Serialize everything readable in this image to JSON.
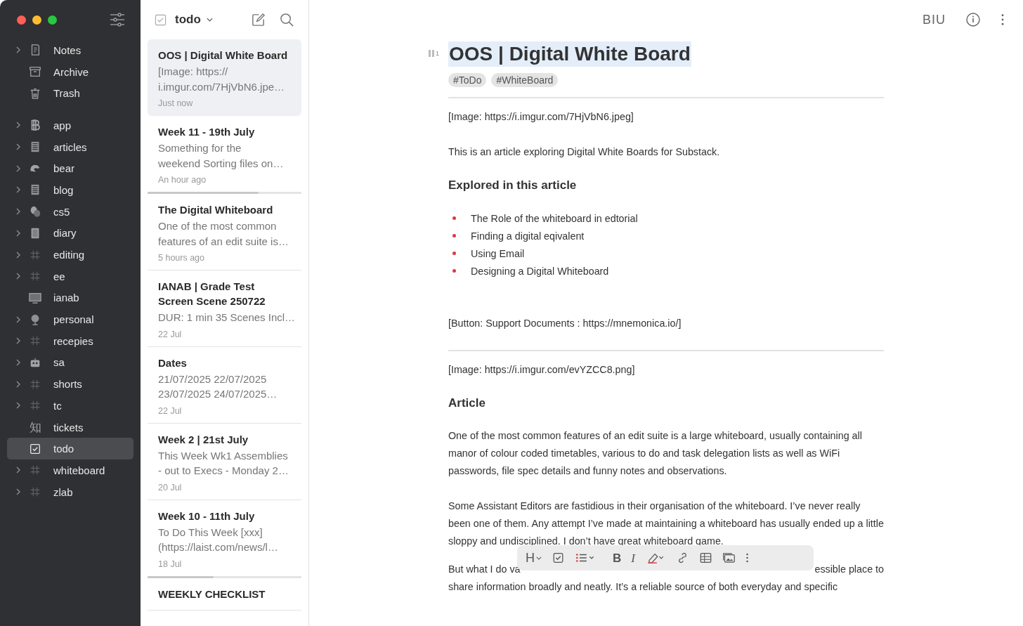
{
  "sidebar": {
    "items": [
      {
        "label": "Notes",
        "expandable": true,
        "selected": false
      },
      {
        "label": "Archive",
        "expandable": false,
        "selected": false
      },
      {
        "label": "Trash",
        "expandable": false,
        "selected": false
      },
      {
        "label": "app",
        "expandable": true,
        "selected": false
      },
      {
        "label": "articles",
        "expandable": true,
        "selected": false
      },
      {
        "label": "bear",
        "expandable": true,
        "selected": false
      },
      {
        "label": "blog",
        "expandable": true,
        "selected": false
      },
      {
        "label": "cs5",
        "expandable": true,
        "selected": false
      },
      {
        "label": "diary",
        "expandable": true,
        "selected": false
      },
      {
        "label": "editing",
        "expandable": true,
        "selected": false
      },
      {
        "label": "ee",
        "expandable": true,
        "selected": false
      },
      {
        "label": "ianab",
        "expandable": false,
        "selected": false
      },
      {
        "label": "personal",
        "expandable": true,
        "selected": false
      },
      {
        "label": "recepies",
        "expandable": true,
        "selected": false
      },
      {
        "label": "sa",
        "expandable": true,
        "selected": false
      },
      {
        "label": "shorts",
        "expandable": true,
        "selected": false
      },
      {
        "label": "tc",
        "expandable": true,
        "selected": false
      },
      {
        "label": "tickets",
        "expandable": false,
        "selected": false,
        "icon_text": "知"
      },
      {
        "label": "todo",
        "expandable": false,
        "selected": true
      },
      {
        "label": "whiteboard",
        "expandable": true,
        "selected": false
      },
      {
        "label": "zlab",
        "expandable": true,
        "selected": false
      }
    ]
  },
  "note_list": {
    "title": "todo",
    "notes": [
      {
        "title": "OOS | Digital White Board",
        "preview": [
          "[Image: https://",
          "i.imgur.com/7HjVbN6.jpe…"
        ],
        "date": "Just now",
        "selected": true
      },
      {
        "title": "Week 11 - 19th July",
        "preview": [
          "Something for the",
          "weekend Sorting files on…"
        ],
        "date": "An hour ago",
        "selected": false,
        "level": 0.72
      },
      {
        "title": "The Digital Whiteboard",
        "preview": [
          "One of the most common",
          "features of an edit suite is…"
        ],
        "date": "5 hours ago",
        "selected": false
      },
      {
        "title": "IANAB | Grade Test Screen Scene 250722",
        "preview": [
          "DUR: 1 min 35 Scenes Incl…"
        ],
        "date": "22 Jul",
        "selected": false
      },
      {
        "title": "Dates",
        "preview": [
          "21/07/2025 22/07/2025",
          "23/07/2025 24/07/2025…"
        ],
        "date": "22 Jul",
        "selected": false
      },
      {
        "title": "Week 2 | 21st July",
        "preview": [
          "This Week Wk1 Assemblies",
          "- out to Execs - Monday 2…"
        ],
        "date": "20 Jul",
        "selected": false
      },
      {
        "title": "Week 10 - 11th July",
        "preview": [
          "To Do This Week [xxx]",
          "(https://laist.com/news/l…"
        ],
        "date": "18 Jul",
        "selected": false,
        "level": 0.43
      },
      {
        "title": "WEEKLY CHECKLIST",
        "selected": false
      }
    ]
  },
  "editor": {
    "toolbar": {
      "format": "BIU"
    },
    "title": "OOS | Digital White Board",
    "heading_level": "1",
    "tags": [
      "#ToDo",
      "#WhiteBoard"
    ],
    "blocks": [
      {
        "kind": "divider"
      },
      {
        "kind": "paragraph",
        "text": "[Image: https://i.imgur.com/7HjVbN6.jpeg]"
      },
      {
        "kind": "paragraph",
        "text": "This is an article exploring Digital White Boards for Substack."
      },
      {
        "kind": "heading",
        "text": "Explored in this article"
      },
      {
        "kind": "bullets",
        "items": [
          "The Role of the whiteboard in edtorial",
          "Finding a digital eqivalent",
          "Using Email",
          "Designing a Digital Whiteboard"
        ]
      },
      {
        "kind": "paragraph",
        "text": "[Button: Support Documents  : https://mnemonica.io/]"
      },
      {
        "kind": "divider"
      },
      {
        "kind": "paragraph",
        "text": "[Image: https://i.imgur.com/evYZCC8.png]"
      },
      {
        "kind": "heading",
        "text": "Article"
      },
      {
        "kind": "paragraph",
        "text": "One of the most common features of an edit suite is a large whiteboard, usually containing all manor of colour coded timetables, various to do and task delegation lists as well as WiFi passwords, file spec details and funny notes and observations."
      },
      {
        "kind": "paragraph",
        "text": "Some Assistant Editors are fastidious in their organisation of the whiteboard. I’ve never really been one of them. Any attempt I’ve made at maintaining a whiteboard has usually ended up a little sloppy and undisciplined. I don’t have great whiteboard game."
      },
      {
        "kind": "covered",
        "left": "But what I do va",
        "right": "essible place to",
        "next": "share information broadly and neatly. It’s a reliable source of both everyday and specific"
      }
    ],
    "format_bar": {
      "heading": "H",
      "bold": "B",
      "italic": "I"
    }
  }
}
